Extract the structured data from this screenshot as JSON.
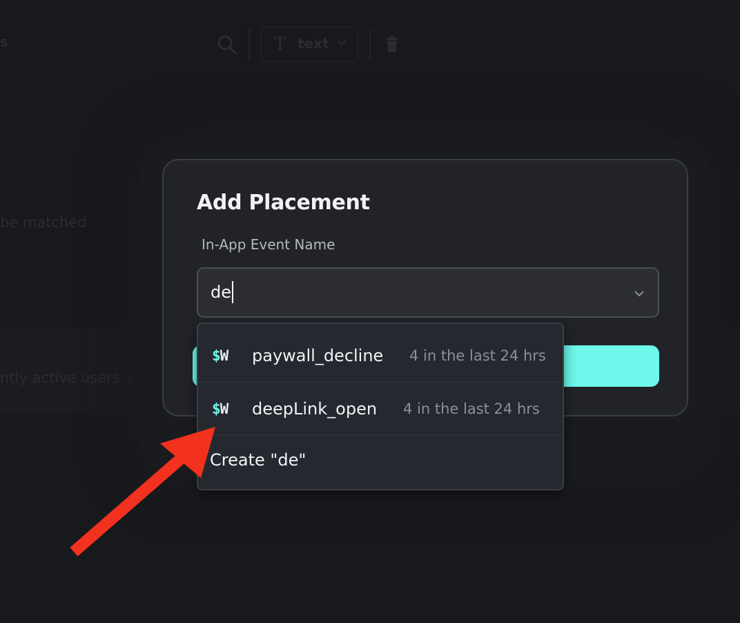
{
  "background": {
    "toolbar_label": "s",
    "text_select": {
      "icon": "T",
      "label": "text"
    },
    "match_text": "be matched",
    "active_link": "ntly active users"
  },
  "modal": {
    "title": "Add Placement",
    "field_label": "In-App Event Name",
    "input_value": "de",
    "submit_button_label": ""
  },
  "dropdown": {
    "options": [
      {
        "badge_symbol": "$",
        "badge_letter": "W",
        "name": "paywall_decline",
        "meta": "4 in the last 24 hrs"
      },
      {
        "badge_symbol": "$",
        "badge_letter": "W",
        "name": "deepLink_open",
        "meta": "4 in the last 24 hrs"
      }
    ],
    "create_label": "Create \"de\""
  },
  "colors": {
    "accent": "#6ef7ea",
    "annotation_arrow": "#f2311e",
    "modal_bg": "#212328",
    "page_bg": "#18191c"
  },
  "icons": [
    "search-icon",
    "text-type-icon",
    "chevron-down-icon",
    "trash-icon",
    "chevron-right-icon",
    "annotation-arrow"
  ]
}
